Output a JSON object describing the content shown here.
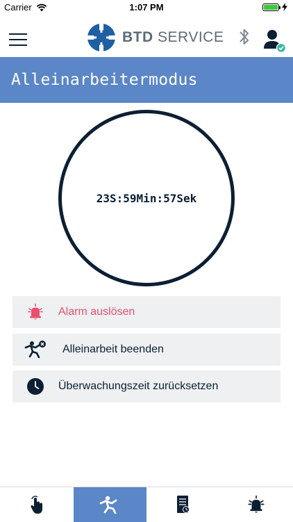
{
  "status_bar": {
    "carrier": "Carrier",
    "time": "1:07 PM",
    "battery_level": 1.0
  },
  "header": {
    "logo_text_bold": "BTD",
    "logo_text_light": "SERVICE",
    "icons": [
      "menu-icon",
      "bluetooth-icon",
      "user-verified-icon"
    ]
  },
  "title": "Alleinarbeitermodus",
  "timer": {
    "display": "23S:59Min:57Sek"
  },
  "actions": [
    {
      "label": "Alarm auslösen",
      "icon": "alarm-bell-icon",
      "color": "#ea4e6e"
    },
    {
      "label": "Alleinarbeit beenden",
      "icon": "fall-person-icon"
    },
    {
      "label": "Überwachungszeit zurücksetzen",
      "icon": "clock-icon"
    }
  ],
  "tabs": [
    {
      "icon": "touch-hand-icon",
      "active": false
    },
    {
      "icon": "falling-person-icon",
      "active": true
    },
    {
      "icon": "log-document-icon",
      "active": false
    },
    {
      "icon": "alarm-icon",
      "active": false
    }
  ],
  "colors": {
    "accent": "#5b86c7",
    "dark": "#0c1f33",
    "alarm": "#ea4e6e",
    "button_bg": "#eef0f2"
  }
}
